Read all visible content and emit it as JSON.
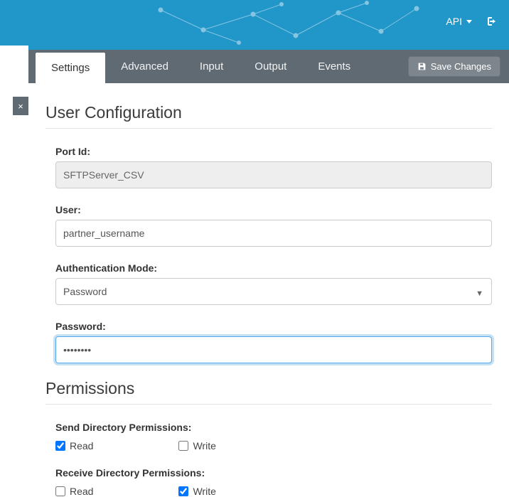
{
  "header": {
    "api_label": "API",
    "logout_icon": "logout-icon"
  },
  "tabs": [
    {
      "label": "Settings",
      "active": true
    },
    {
      "label": "Advanced",
      "active": false
    },
    {
      "label": "Input",
      "active": false
    },
    {
      "label": "Output",
      "active": false
    },
    {
      "label": "Events",
      "active": false
    }
  ],
  "save_button": "Save Changes",
  "close_tab": "×",
  "section_title": "User Configuration",
  "fields": {
    "port_id_label": "Port Id:",
    "port_id_value": "SFTPServer_CSV",
    "user_label": "User:",
    "user_value": "partner_username",
    "auth_mode_label": "Authentication Mode:",
    "auth_mode_value": "Password",
    "password_label": "Password:",
    "password_value": "••••••••"
  },
  "permissions_title": "Permissions",
  "permissions": {
    "send_label": "Send Directory Permissions:",
    "receive_label": "Receive Directory Permissions:",
    "read_label": "Read",
    "write_label": "Write",
    "send_read": true,
    "send_write": false,
    "receive_read": false,
    "receive_write": true
  }
}
